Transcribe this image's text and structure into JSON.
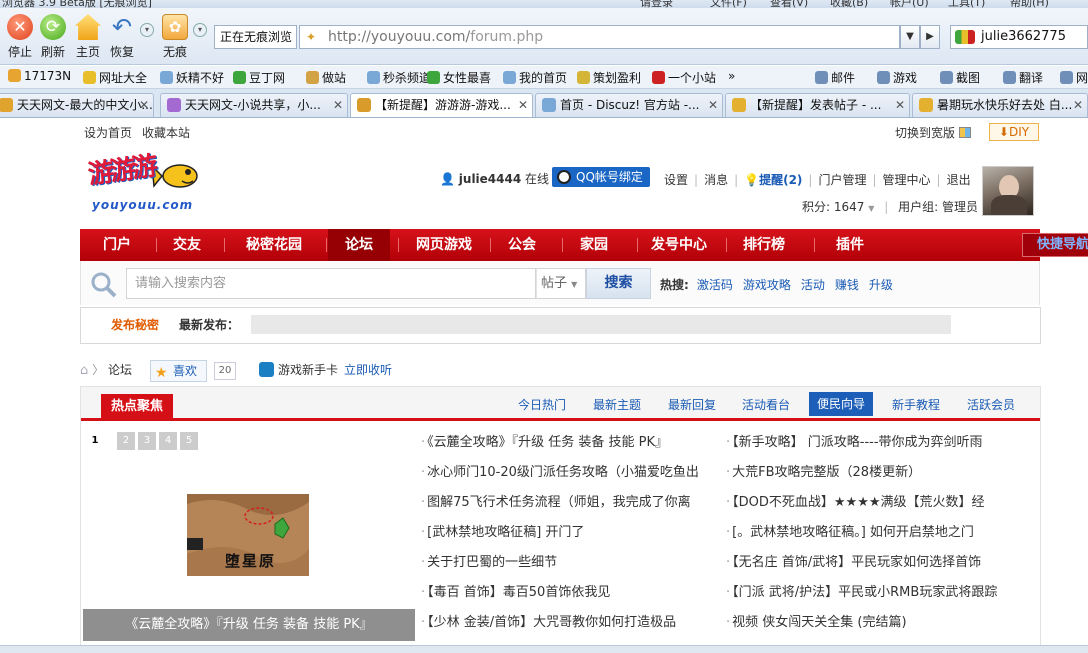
{
  "window": {
    "title": "浏览器 3.9 Beta版 [无痕浏览]",
    "menu": [
      "请登录",
      "文件(F)",
      "查看(V)",
      "收藏(B)",
      "帐户(U)",
      "工具(T)",
      "帮助(H)"
    ]
  },
  "toolbar": {
    "buttons": [
      {
        "label": "停止",
        "icon": "stop-icon"
      },
      {
        "label": "刷新",
        "icon": "refresh-icon"
      },
      {
        "label": "主页",
        "icon": "home-icon"
      },
      {
        "label": "恢复",
        "icon": "undo-icon"
      },
      {
        "label": "无痕",
        "icon": "incognito-paw-icon"
      }
    ],
    "mode_label": "正在无痕浏览",
    "url_host": "http://youyouu.com/",
    "url_path": "forum.php",
    "account": "julie3662775"
  },
  "bookmarks": [
    {
      "label": "17173N",
      "color": "#e8a431"
    },
    {
      "label": "网址大全",
      "color": "#e8bf2a"
    },
    {
      "label": "妖精不好",
      "color": "#7aa8d6"
    },
    {
      "label": "豆丁网",
      "color": "#3da63d"
    },
    {
      "label": "做站",
      "color": "#d3a244"
    },
    {
      "label": "秒杀频道",
      "color": "#7aa8d6"
    },
    {
      "label": "女性最喜",
      "color": "#3da63d"
    },
    {
      "label": "我的首页",
      "color": "#7aa8d6"
    },
    {
      "label": "策划盈利",
      "color": "#d4b537"
    },
    {
      "label": "一个小站",
      "color": "#cc2222"
    },
    {
      "label": "»",
      "color": ""
    },
    {
      "label": "邮件",
      "color": "#6f8fb8"
    },
    {
      "label": "游戏",
      "color": "#6f8fb8"
    },
    {
      "label": "截图",
      "color": "#6f8fb8"
    },
    {
      "label": "翻译",
      "color": "#6f8fb8"
    },
    {
      "label": "网",
      "color": "#6f8fb8"
    }
  ],
  "tabs": [
    {
      "label": "天天网文-最大的中文小...",
      "color": "#e0a32e"
    },
    {
      "label": "天天网文-小说共享，小...",
      "color": "#a36ad1"
    },
    {
      "label": "【新提醒】游游游-游戏...",
      "color": "#d99b2a"
    },
    {
      "label": "首页 - Discuz! 官方站 -...",
      "color": "#7aa8d6"
    },
    {
      "label": "【新提醒】发表帖子 - ...",
      "color": "#e3b02f"
    },
    {
      "label": "暑期玩水快乐好去处 白...",
      "color": "#e3b02f"
    }
  ],
  "site": {
    "top_links": [
      "设为首页",
      "收藏本站"
    ],
    "wide_switch": "切换到宽版",
    "diy": "DIY",
    "logo_cn": "游游游",
    "logo_en": "youyouu.com",
    "user": {
      "name": "julie4444",
      "status": "在线",
      "qq_bind": "QQ帐号绑定",
      "links": [
        "设置",
        "消息",
        "提醒(2)",
        "门户管理",
        "管理中心",
        "退出"
      ],
      "points": "积分: 1647",
      "group": "用户组: 管理员"
    },
    "nav": [
      "门户",
      "交友",
      "秘密花园",
      "论坛",
      "网页游戏",
      "公会",
      "家园",
      "发号中心",
      "排行榜",
      "插件"
    ],
    "nav_active": "论坛",
    "quick_nav": "快捷导航",
    "search": {
      "placeholder": "请输入搜索内容",
      "type": "帖子",
      "button": "搜索",
      "hot_label": "热搜:",
      "hot": [
        "激活码",
        "游戏攻略",
        "活动",
        "赚钱",
        "升级"
      ]
    },
    "new_post": {
      "a": "发布秘密",
      "b": "最新发布："
    },
    "breadcrumb": "论坛",
    "like_label": "喜欢",
    "like_count": "20",
    "card_label": "游戏新手卡",
    "card_link": "立即收听",
    "hot": {
      "title": "热点聚焦",
      "tabs": [
        "今日热门",
        "最新主题",
        "最新回复",
        "活动看台",
        "便民向导",
        "新手教程",
        "活跃会员"
      ],
      "active_tab": "便民向导",
      "pages": [
        "1",
        "2",
        "3",
        "4",
        "5"
      ],
      "map_text": "堕星原",
      "caption": "《云麓全攻略》『升级 任务 装备 技能 PK』",
      "left_posts": [
        "《云麓全攻略》『升级 任务 装备 技能 PK』",
        "冰心师门10-20级门派任务攻略（小猫爱吃鱼出",
        "图解75飞行术任务流程（师姐，我完成了你离",
        "[武林禁地攻略征稿] 开门了",
        "关于打巴蜀的一些细节",
        "【毒百 首饰】毒百50首饰依我见",
        "【少林 金装/首饰】大咒哥教你如何打造极品"
      ],
      "right_posts": [
        "【新手攻略】 门派攻略----带你成为弈剑听雨",
        "大荒FB攻略完整版（28楼更新）",
        "【DOD不死血战】★★★★满级【荒火数】经",
        "[。武林禁地攻略征稿。] 如何开启禁地之门",
        "【无名庄 首饰/武将】平民玩家如何选择首饰",
        "【门派 武将/护法】平民或小RMB玩家武将跟踪",
        "视频 侠女闯天关全集 (完结篇)"
      ]
    }
  }
}
